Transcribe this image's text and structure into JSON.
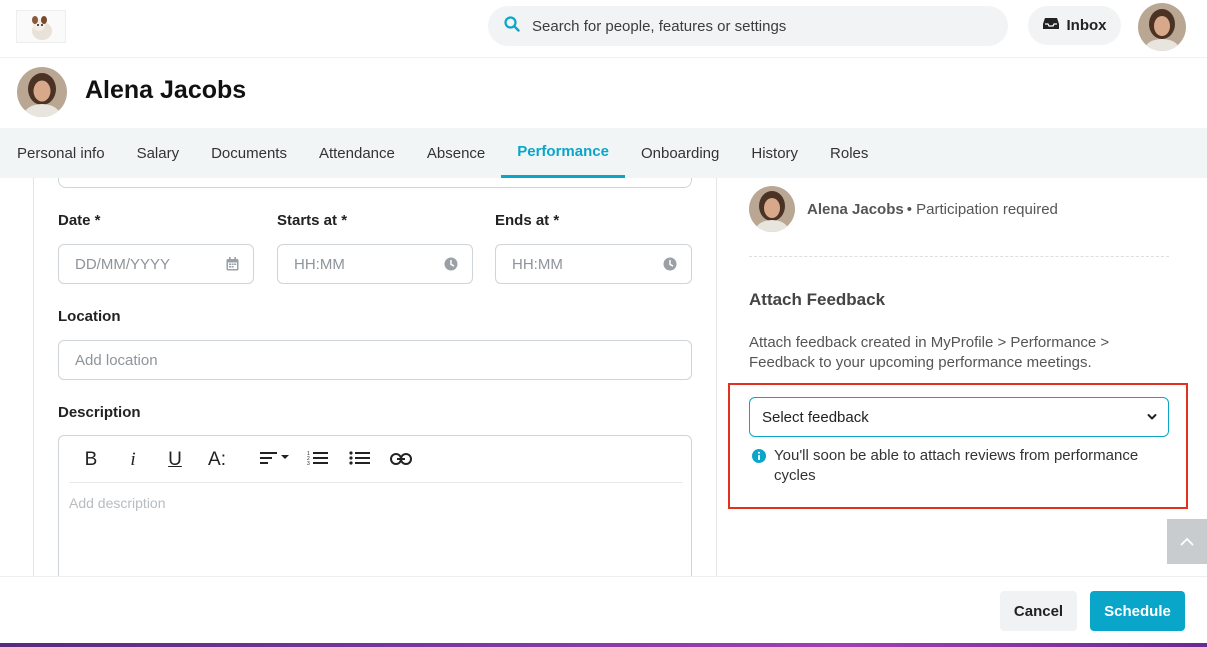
{
  "header": {
    "search_placeholder": "Search for people, features or settings",
    "inbox_label": "Inbox"
  },
  "profile": {
    "name": "Alena Jacobs"
  },
  "tabs": [
    {
      "label": "Personal info",
      "active": false
    },
    {
      "label": "Salary",
      "active": false
    },
    {
      "label": "Documents",
      "active": false
    },
    {
      "label": "Attendance",
      "active": false
    },
    {
      "label": "Absence",
      "active": false
    },
    {
      "label": "Performance",
      "active": true
    },
    {
      "label": "Onboarding",
      "active": false
    },
    {
      "label": "History",
      "active": false
    },
    {
      "label": "Roles",
      "active": false
    }
  ],
  "form": {
    "date_label": "Date *",
    "date_placeholder": "DD/MM/YYYY",
    "starts_label": "Starts at *",
    "starts_placeholder": "HH:MM",
    "ends_label": "Ends at *",
    "ends_placeholder": "HH:MM",
    "location_label": "Location",
    "location_placeholder": "Add location",
    "description_label": "Description",
    "description_placeholder": "Add description",
    "toolbar": {
      "bold": "B",
      "italic": "i",
      "underline": "U",
      "font_size": "A:"
    }
  },
  "participant": {
    "name": "Alena Jacobs",
    "status": "• Participation required"
  },
  "attach": {
    "title": "Attach Feedback",
    "description": "Attach feedback created in MyProfile > Performance > Feedback to your upcoming performance meetings.",
    "select_value": "Select feedback",
    "info_text": "You'll soon be able to attach reviews from performance cycles"
  },
  "footer": {
    "cancel_label": "Cancel",
    "schedule_label": "Schedule"
  },
  "colors": {
    "accent": "#0aa6c9",
    "highlight": "#e0321e"
  }
}
